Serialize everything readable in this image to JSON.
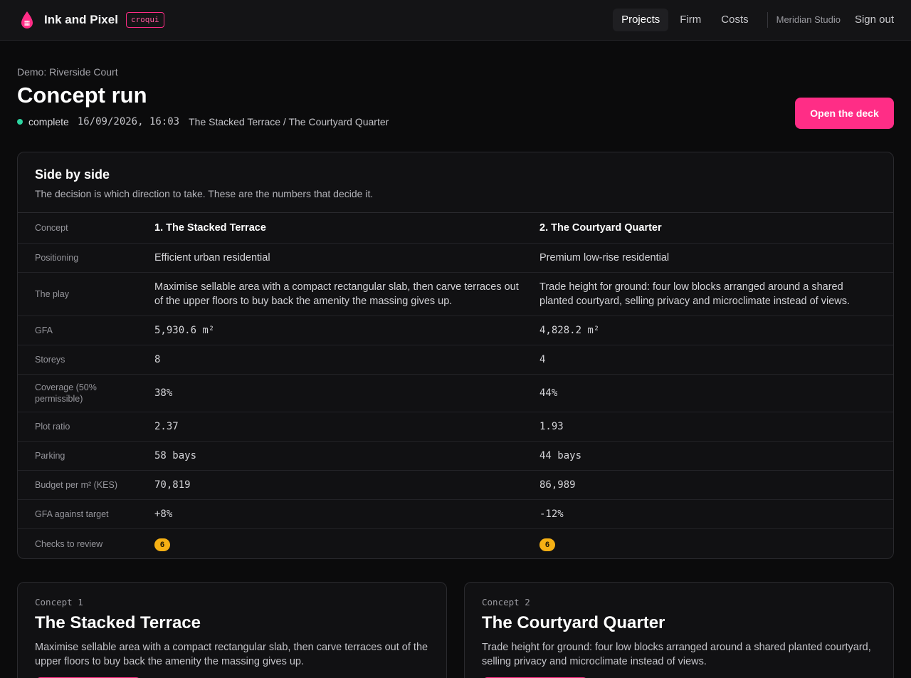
{
  "header": {
    "brand_name": "Ink and Pixel",
    "brand_tag": "croqui",
    "nav": [
      {
        "label": "Projects",
        "active": true
      },
      {
        "label": "Firm",
        "active": false
      },
      {
        "label": "Costs",
        "active": false
      }
    ],
    "org": "Meridian Studio",
    "sign_out": "Sign out"
  },
  "page": {
    "breadcrumb": "Demo: Riverside Court",
    "title": "Concept run",
    "status": "complete",
    "status_color": "#2dd4a0",
    "timestamp": "16/09/2026, 16:03",
    "concepts_line": "The Stacked Terrace / The Courtyard Quarter",
    "open_deck_label": "Open the deck"
  },
  "comparison": {
    "title": "Side by side",
    "subtitle": "The decision is which direction to take. These are the numbers that decide it.",
    "rows": [
      {
        "label": "Concept",
        "c1": "1. The Stacked Terrace",
        "c2": "2. The Courtyard Quarter"
      },
      {
        "label": "Positioning",
        "c1": "Efficient urban residential",
        "c2": "Premium low-rise residential"
      },
      {
        "label": "The play",
        "c1": "Maximise sellable area with a compact rectangular slab, then carve terraces out of the upper floors to buy back the amenity the massing gives up.",
        "c2": "Trade height for ground: four low blocks arranged around a shared planted courtyard, selling privacy and microclimate instead of views."
      },
      {
        "label": "GFA",
        "c1": "5,930.6 m²",
        "c2": "4,828.2 m²"
      },
      {
        "label": "Storeys",
        "c1": "8",
        "c2": "4"
      },
      {
        "label": "Coverage (50% permissible)",
        "c1": "38%",
        "c2": "44%"
      },
      {
        "label": "Plot ratio",
        "c1": "2.37",
        "c2": "1.93"
      },
      {
        "label": "Parking",
        "c1": "58 bays",
        "c2": "44 bays"
      },
      {
        "label": "Budget per m² (KES)",
        "c1": "70,819",
        "c2": "86,989"
      },
      {
        "label": "GFA against target",
        "c1": "+8%",
        "c2": "-12%"
      },
      {
        "label": "Checks to review",
        "c1": "6",
        "c2": "6"
      }
    ]
  },
  "concept_cards": [
    {
      "kicker": "Concept 1",
      "title": "The Stacked Terrace",
      "description": "Maximise sellable area with a compact rectangular slab, then carve terraces out of the upper floors to buy back the amenity the massing gives up."
    },
    {
      "kicker": "Concept 2",
      "title": "The Courtyard Quarter",
      "description": "Trade height for ground: four low blocks arranged around a shared planted courtyard, selling privacy and microclimate instead of views."
    }
  ],
  "colors": {
    "accent": "#ff2d86",
    "badge": "#f5b014",
    "background": "#0b0b0c"
  }
}
